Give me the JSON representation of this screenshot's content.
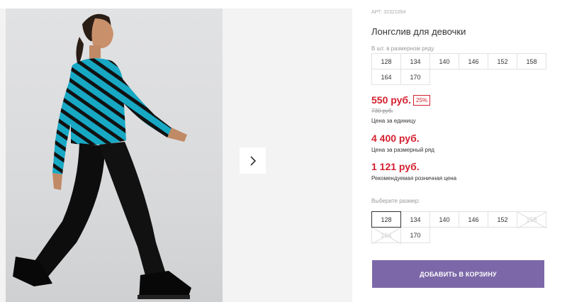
{
  "product": {
    "article_label": "АРТ:",
    "article_number": "32321094",
    "title": "Лонгслив для девочки"
  },
  "size_row": {
    "hint": "В шт. в размерном ряду",
    "sizes": [
      "128",
      "134",
      "140",
      "146",
      "152",
      "158",
      "164",
      "170"
    ]
  },
  "pricing": {
    "price": "550 руб.",
    "discount_badge": "25%",
    "old_price": "730 руб.",
    "price_caption": "Цена за единицу",
    "row_price": "4 400 руб.",
    "row_caption": "Цена за размерный ряд",
    "retail_price": "1 121 руб.",
    "retail_caption": "Рекомендуемая розничная цена"
  },
  "size_select": {
    "hint": "Выберите размер:",
    "sizes": [
      "128",
      "134",
      "140",
      "146",
      "152",
      "158",
      "164",
      "170"
    ],
    "selected": "128",
    "unavailable": [
      "158",
      "164"
    ]
  },
  "cart_button_label": "ДОБАВИТЬ В КОРЗИНУ",
  "colors": {
    "accent_red": "#d4202f",
    "button_purple": "#7c68a8",
    "shirt_teal": "#17a8c4"
  },
  "icons": {
    "next": "chevron-right-icon",
    "unavailable": "cross-out-icon"
  }
}
